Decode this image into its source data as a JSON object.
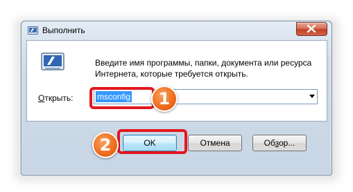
{
  "window": {
    "title": "Выполнить",
    "description": "Введите имя программы, папки, документа или ресурса Интернета, которые требуется открыть."
  },
  "open_field": {
    "label_accel": "О",
    "label_rest": "ткрыть:",
    "value": "msconfig"
  },
  "buttons": {
    "ok": "OK",
    "cancel": "Отмена",
    "browse_pre": "Об",
    "browse_accel": "з",
    "browse_post": "ор..."
  },
  "annotations": {
    "step1": "1",
    "step2": "2",
    "highlight_color": "#e3161f",
    "badge_color": "#ef6a1c"
  },
  "icons": {
    "title": "run-icon",
    "close": "close-icon",
    "dialog": "run-icon",
    "dropdown": "chevron-down-icon"
  }
}
